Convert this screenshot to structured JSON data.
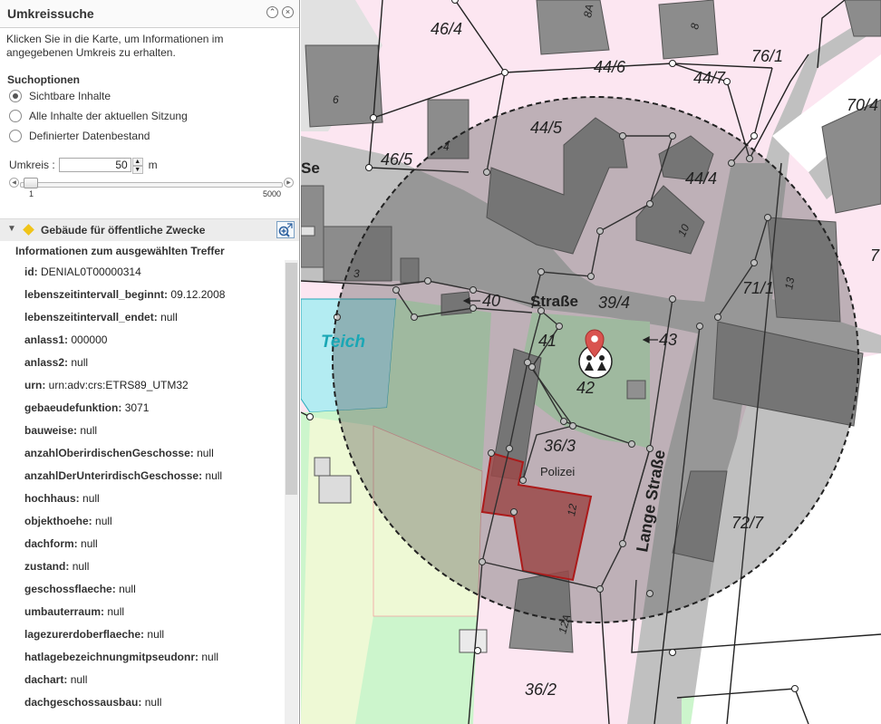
{
  "panel": {
    "title": "Umkreissuche",
    "description": "Klicken Sie in die Karte, um Informationen im angegebenen Umkreis zu erhalten.",
    "search_options_label": "Suchoptionen",
    "options": [
      {
        "label": "Sichtbare Inhalte",
        "checked": true
      },
      {
        "label": "Alle Inhalte der aktuellen Sitzung",
        "checked": false
      },
      {
        "label": "Definierter Datenbestand",
        "checked": false
      }
    ],
    "radius_label": "Umkreis :",
    "radius_value": "50",
    "radius_unit": "m",
    "slider": {
      "min": "1",
      "max": "5000",
      "value": 50
    },
    "result_group": "Gebäude für öffentliche Zwecke",
    "info_title": "Informationen zum ausgewählten Treffer",
    "attributes": [
      {
        "key": "id:",
        "value": "DENIAL0T00000314"
      },
      {
        "key": "lebenszeitintervall_beginnt:",
        "value": "09.12.2008"
      },
      {
        "key": "lebenszeitintervall_endet:",
        "value": "null"
      },
      {
        "key": "anlass1:",
        "value": "000000"
      },
      {
        "key": "anlass2:",
        "value": "null"
      },
      {
        "key": "urn:",
        "value": "urn:adv:crs:ETRS89_UTM32"
      },
      {
        "key": "gebaeudefunktion:",
        "value": "3071"
      },
      {
        "key": "bauweise:",
        "value": "null"
      },
      {
        "key": "anzahlOberirdischenGeschosse:",
        "value": "null"
      },
      {
        "key": "anzahlDerUnterirdischGeschosse:",
        "value": "null"
      },
      {
        "key": "hochhaus:",
        "value": "null"
      },
      {
        "key": "objekthoehe:",
        "value": "null"
      },
      {
        "key": "dachform:",
        "value": "null"
      },
      {
        "key": "zustand:",
        "value": "null"
      },
      {
        "key": "geschossflaeche:",
        "value": "null"
      },
      {
        "key": "umbauterraum:",
        "value": "null"
      },
      {
        "key": "lagezurerdoberflaeche:",
        "value": "null"
      },
      {
        "key": "hatlagebezeichnungmitpseudonr:",
        "value": "null"
      },
      {
        "key": "dachart:",
        "value": "null"
      },
      {
        "key": "dachgeschossausbau:",
        "value": "null"
      }
    ]
  },
  "map": {
    "parcel_labels": [
      "46/4",
      "8A",
      "8",
      "76/1",
      "44/6",
      "44/7",
      "70/4",
      "6",
      "4",
      "44/5",
      "46/5",
      "44/4",
      "10",
      "7",
      "3",
      "71/1",
      "13",
      "39/4",
      "41",
      "42",
      "43",
      "36/3",
      "72/7",
      "36/2",
      "12",
      "12A"
    ],
    "street_labels": [
      "Straße",
      "Lange Straße",
      "Se"
    ],
    "leader_labels": [
      "40",
      "43"
    ],
    "water_label": "Teich",
    "building_label": "Polizei",
    "colors": {
      "parcel": "#fce6f1",
      "road": "#bfbfbf",
      "building": "#8c8c8c",
      "water": "#b3ecf2",
      "green": "#ccf5cc",
      "lightgreen": "#eef9d5",
      "highlight": "#e00000",
      "circle": "#4a4a4a"
    }
  }
}
